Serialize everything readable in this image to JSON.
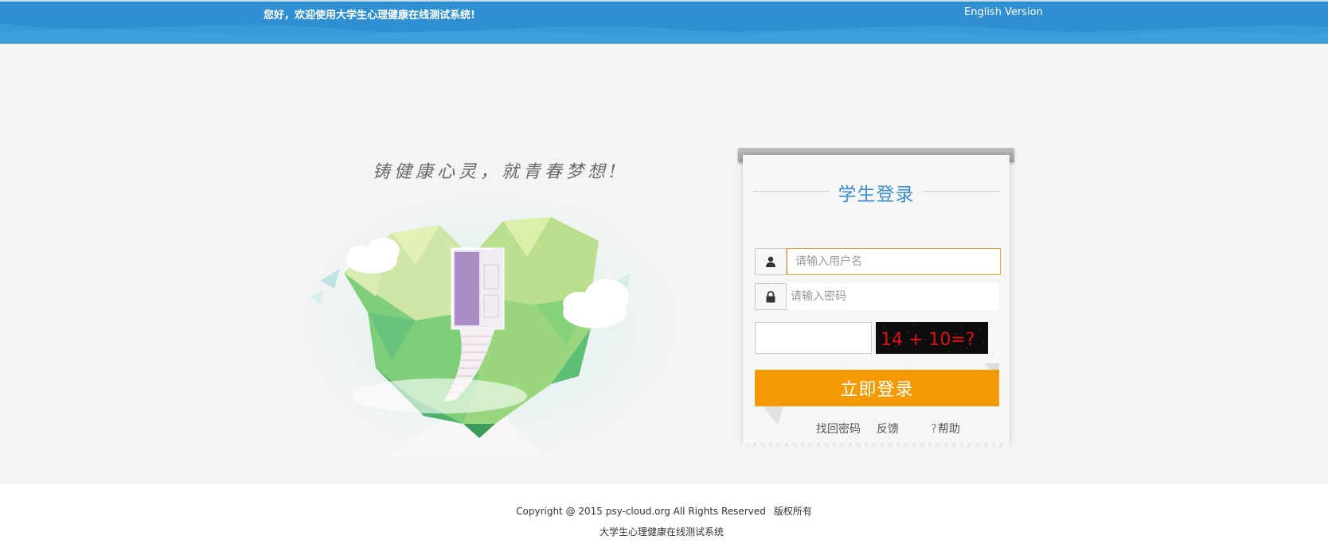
{
  "header": {
    "welcome_text": "您好，欢迎使用大学生心理健康在线测试系统!",
    "language_link": "English Version",
    "background_color": "#2f8fd0"
  },
  "hero": {
    "slogan": "铸健康心灵，就青春梦想!",
    "illustration": "heart-door-clouds-illustration"
  },
  "login": {
    "title": "学生登录",
    "title_color": "#3a8fd3",
    "username": {
      "placeholder": "请输入用户名",
      "value": "",
      "icon": "user-icon"
    },
    "password": {
      "placeholder": "请输入密码",
      "value": "",
      "icon": "lock-icon"
    },
    "captcha": {
      "input_value": "",
      "image_text": "14 + 10=?"
    },
    "submit_label": "立即登录",
    "submit_color": "#f39a06",
    "links": {
      "forgot_password": "找回密码",
      "feedback": "反馈",
      "help": "帮助",
      "help_icon": "question-mark-icon"
    }
  },
  "footer": {
    "copyright": "Copyright @ 2015 psy-cloud.org All Rights Reserved",
    "rights": "版权所有",
    "system_name": "大学生心理健康在线测试系统"
  }
}
